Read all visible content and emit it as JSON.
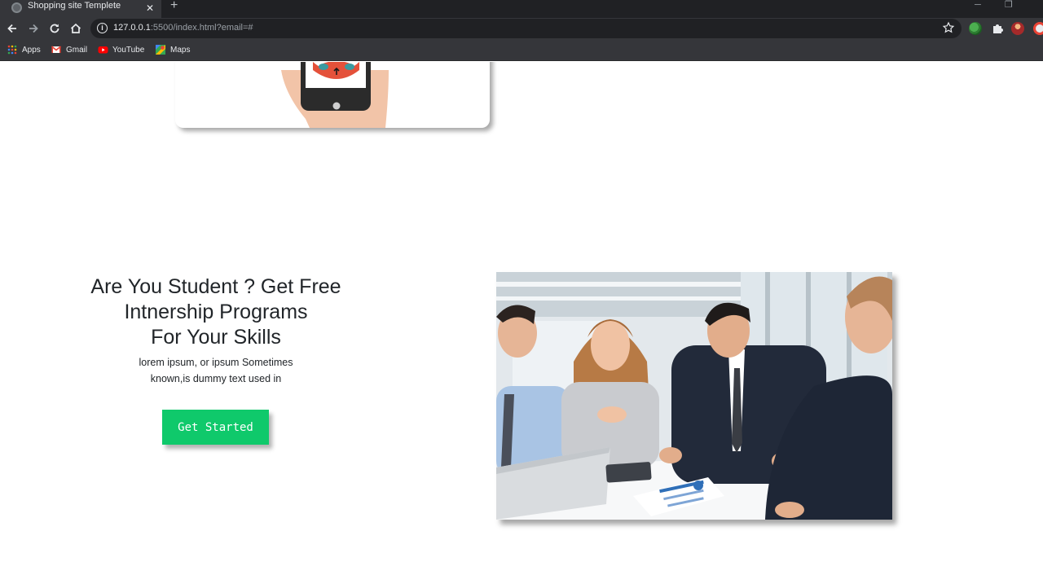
{
  "browser": {
    "tab_title": "Shopping site Templete",
    "url_host": "127.0.0.1",
    "url_rest": ":5500/index.html?email=#",
    "bookmarks": [
      "Apps",
      "Gmail",
      "YouTube",
      "Maps"
    ]
  },
  "hero": {
    "title_line1": "Are You Student ? Get Free",
    "title_line2": "Intnership Programs",
    "title_line3": "For Your Skills",
    "text_line1": "lorem ipsum, or ipsum Sometimes",
    "text_line2": "known,is dummy text used in",
    "cta_label": "Get Started",
    "cta_color": "#0fc96b"
  }
}
